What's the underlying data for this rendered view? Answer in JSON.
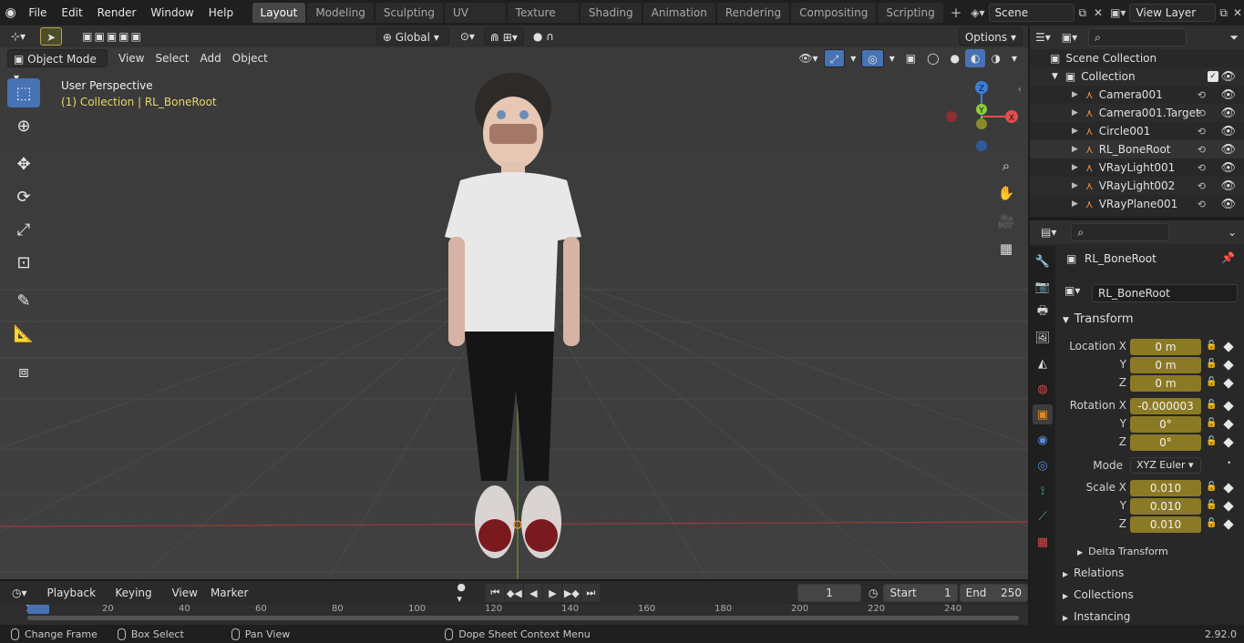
{
  "menu": [
    "File",
    "Edit",
    "Render",
    "Window",
    "Help"
  ],
  "workspaces": [
    "Layout",
    "Modeling",
    "Sculpting",
    "UV Editing",
    "Texture Paint",
    "Shading",
    "Animation",
    "Rendering",
    "Compositing",
    "Scripting"
  ],
  "scene": "Scene",
  "view_layer": "View Layer",
  "viewport": {
    "transform_orientation": "Global",
    "options_label": "Options",
    "mode": "Object Mode",
    "header_menus": [
      "View",
      "Select",
      "Add",
      "Object"
    ],
    "overlay_title": "User Perspective",
    "overlay_subtitle": "(1) Collection | RL_BoneRoot",
    "gizmo": {
      "x": "X",
      "y": "Y",
      "z": "Z"
    }
  },
  "timeline": {
    "menus": [
      "Playback",
      "Keying",
      "View",
      "Marker"
    ],
    "current_frame": "1",
    "start_label": "Start",
    "start_value": "1",
    "end_label": "End",
    "end_value": "250",
    "ruler": [
      "1",
      "20",
      "40",
      "60",
      "80",
      "100",
      "120",
      "140",
      "160",
      "180",
      "200",
      "220",
      "240"
    ]
  },
  "statusbar": {
    "items": [
      "Change Frame",
      "Box Select",
      "Pan View",
      "Dope Sheet Context Menu"
    ],
    "version": "2.92.0"
  },
  "outliner": {
    "scene_collection": "Scene Collection",
    "collection": "Collection",
    "items": [
      "Camera001",
      "Camera001.Target",
      "Circle001",
      "RL_BoneRoot",
      "VRayLight001",
      "VRayLight002",
      "VRayPlane001"
    ]
  },
  "properties": {
    "object_name": "RL_BoneRoot",
    "object_field": "RL_BoneRoot",
    "transform_header": "Transform",
    "location_label": "Location X",
    "location": [
      "0 m",
      "0 m",
      "0 m"
    ],
    "rotation_label": "Rotation X",
    "rotation": [
      "-0.000003",
      "0°",
      "0°"
    ],
    "mode_label": "Mode",
    "mode_value": "XYZ Euler",
    "scale_label": "Scale X",
    "scale": [
      "0.010",
      "0.010",
      "0.010"
    ],
    "axis_y": "Y",
    "axis_z": "Z",
    "subsections": [
      "Delta Transform"
    ],
    "panels": [
      "Relations",
      "Collections",
      "Instancing"
    ]
  },
  "colors": {
    "accent": "#4772b3",
    "field_yellow": "#8b7a25",
    "axis_x": "#e54d4d",
    "axis_y": "#8bcf3c",
    "axis_z": "#3b7fe0"
  }
}
